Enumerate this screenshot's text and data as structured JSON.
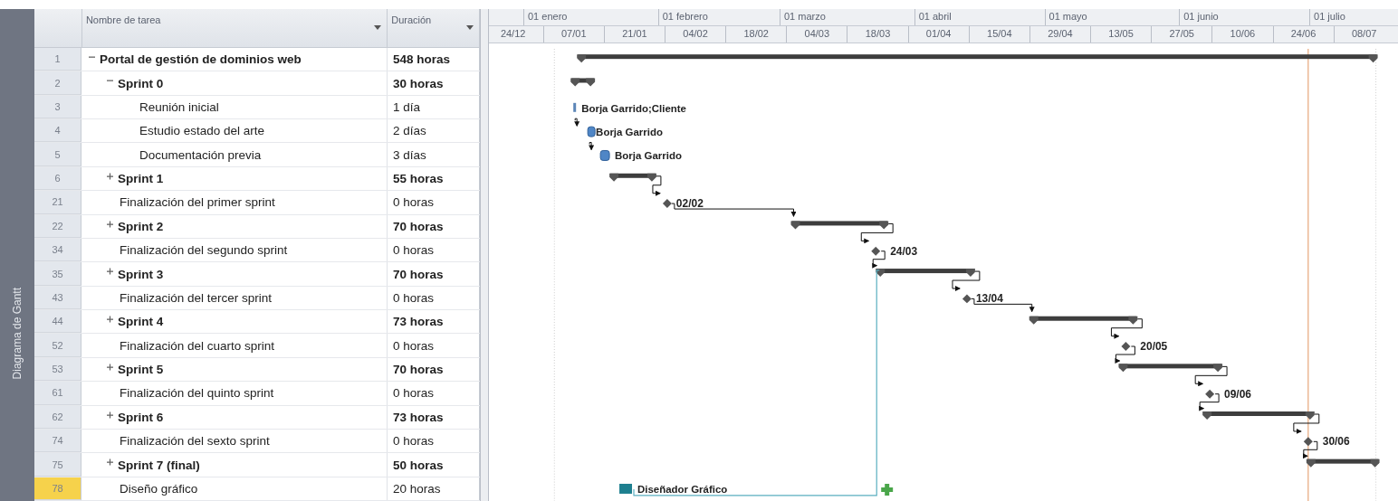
{
  "side_label": "Diagrama de Gantt",
  "columns": [
    {
      "label": "Nombre de tarea"
    },
    {
      "label": "Duración"
    }
  ],
  "timescale": {
    "months": [
      "01 enero",
      "01 febrero",
      "01 marzo",
      "01 abril",
      "01 mayo",
      "01 junio",
      "01 julio"
    ],
    "weeks": [
      "24/12",
      "07/01",
      "21/01",
      "04/02",
      "18/02",
      "04/03",
      "18/03",
      "01/04",
      "15/04",
      "29/04",
      "13/05",
      "27/05",
      "10/06",
      "24/06",
      "08/07"
    ]
  },
  "tasks": [
    {
      "id": "1",
      "name": "Portal de gestión de dominios web",
      "duration": "548 horas",
      "kind": "summary",
      "expanded": true,
      "selected": false,
      "children": [
        {
          "id": "2",
          "name": "Sprint 0",
          "duration": "30 horas",
          "kind": "summary",
          "expanded": true,
          "selected": false,
          "children": [
            {
              "id": "3",
              "name": "Reunión inicial",
              "duration": "1 día",
              "kind": "task",
              "selected": false,
              "bar_label": "Borja Garrido;Cliente"
            },
            {
              "id": "4",
              "name": "Estudio estado del arte",
              "duration": "2 días",
              "kind": "task",
              "selected": false,
              "bar_label": "Borja Garrido"
            },
            {
              "id": "5",
              "name": "Documentación previa",
              "duration": "3 días",
              "kind": "task",
              "selected": false,
              "bar_label": "Borja Garrido"
            }
          ]
        },
        {
          "id": "6",
          "name": "Sprint 1",
          "duration": "55 horas",
          "kind": "summary",
          "expanded": false,
          "selected": false
        },
        {
          "id": "21",
          "name": "Finalización del primer sprint",
          "duration": "0 horas",
          "kind": "milestone",
          "selected": false,
          "bar_label": "02/02"
        },
        {
          "id": "22",
          "name": "Sprint 2",
          "duration": "70 horas",
          "kind": "summary",
          "expanded": false,
          "selected": false
        },
        {
          "id": "34",
          "name": "Finalización del segundo sprint",
          "duration": "0 horas",
          "kind": "milestone",
          "selected": false,
          "bar_label": "24/03"
        },
        {
          "id": "35",
          "name": "Sprint 3",
          "duration": "70 horas",
          "kind": "summary",
          "expanded": false,
          "selected": false
        },
        {
          "id": "43",
          "name": "Finalización del tercer sprint",
          "duration": "0 horas",
          "kind": "milestone",
          "selected": false,
          "bar_label": "13/04"
        },
        {
          "id": "44",
          "name": "Sprint 4",
          "duration": "73 horas",
          "kind": "summary",
          "expanded": false,
          "selected": false
        },
        {
          "id": "52",
          "name": "Finalización del cuarto sprint",
          "duration": "0 horas",
          "kind": "milestone",
          "selected": false,
          "bar_label": "20/05"
        },
        {
          "id": "53",
          "name": "Sprint 5",
          "duration": "70 horas",
          "kind": "summary",
          "expanded": false,
          "selected": false
        },
        {
          "id": "61",
          "name": "Finalización del quinto sprint",
          "duration": "0 horas",
          "kind": "milestone",
          "selected": false,
          "bar_label": "09/06"
        },
        {
          "id": "62",
          "name": "Sprint 6",
          "duration": "73 horas",
          "kind": "summary",
          "expanded": false,
          "selected": false
        },
        {
          "id": "74",
          "name": "Finalización del sexto sprint",
          "duration": "0 horas",
          "kind": "milestone",
          "selected": false,
          "bar_label": "30/06"
        },
        {
          "id": "75",
          "name": "Sprint 7 (final)",
          "duration": "50 horas",
          "kind": "summary",
          "expanded": false,
          "selected": false
        },
        {
          "id": "78",
          "name": "Diseño gráfico",
          "duration": "20 horas",
          "kind": "resource_task",
          "selected": true,
          "bar_label": "Diseñador Gráfico"
        }
      ]
    }
  ]
}
